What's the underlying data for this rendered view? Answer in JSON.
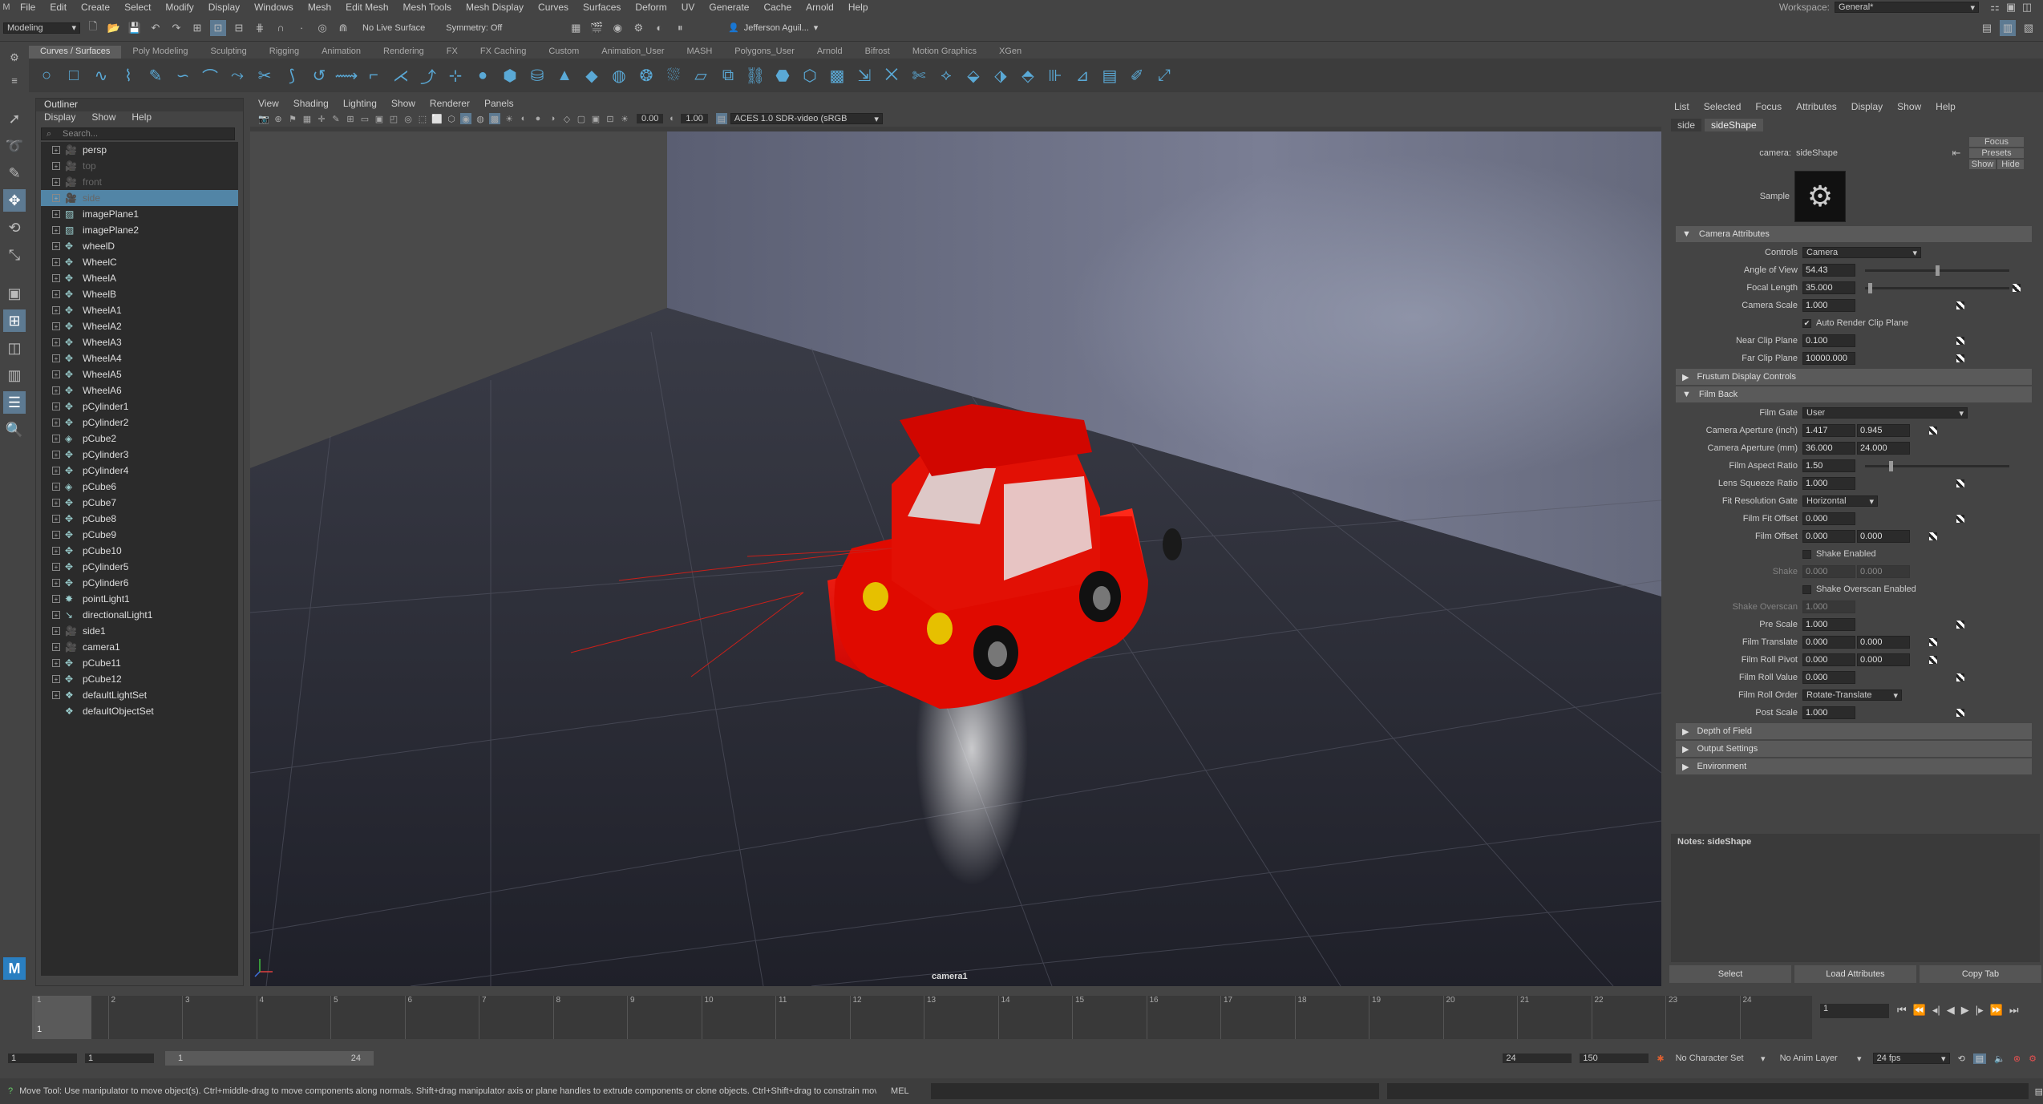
{
  "menubar": {
    "items": [
      "File",
      "Edit",
      "Create",
      "Select",
      "Modify",
      "Display",
      "Windows",
      "Mesh",
      "Edit Mesh",
      "Mesh Tools",
      "Mesh Display",
      "Curves",
      "Surfaces",
      "Deform",
      "UV",
      "Generate",
      "Cache",
      "Arnold",
      "Help"
    ],
    "workspace_label": "Workspace:",
    "workspace_value": "General*"
  },
  "statusline": {
    "mode": "Modeling",
    "live_surface": "No Live Surface",
    "symmetry": "Symmetry: Off",
    "user": "Jefferson Aguil..."
  },
  "shelf": {
    "tabs": [
      "Curves / Surfaces",
      "Poly Modeling",
      "Sculpting",
      "Rigging",
      "Animation",
      "Rendering",
      "FX",
      "FX Caching",
      "Custom",
      "Animation_User",
      "MASH",
      "Polygons_User",
      "Arnold",
      "Bifrost",
      "Motion Graphics",
      "XGen"
    ],
    "active_tab": "Curves / Surfaces"
  },
  "outliner": {
    "title": "Outliner",
    "menu": [
      "Display",
      "Show",
      "Help"
    ],
    "search_placeholder": "Search...",
    "items": [
      {
        "name": "persp",
        "icon": "camera-icon",
        "dim": false
      },
      {
        "name": "top",
        "icon": "camera-icon",
        "dim": true
      },
      {
        "name": "front",
        "icon": "camera-icon",
        "dim": true
      },
      {
        "name": "side",
        "icon": "camera-icon",
        "dim": true,
        "selected": true
      },
      {
        "name": "imagePlane1",
        "icon": "image-plane-icon"
      },
      {
        "name": "imagePlane2",
        "icon": "image-plane-icon"
      },
      {
        "name": "wheelD",
        "icon": "transform-icon"
      },
      {
        "name": "WheelC",
        "icon": "transform-icon"
      },
      {
        "name": "WheelA",
        "icon": "transform-icon"
      },
      {
        "name": "WheelB",
        "icon": "transform-icon"
      },
      {
        "name": "WheelA1",
        "icon": "transform-icon"
      },
      {
        "name": "WheelA2",
        "icon": "transform-icon"
      },
      {
        "name": "WheelA3",
        "icon": "transform-icon"
      },
      {
        "name": "WheelA4",
        "icon": "transform-icon"
      },
      {
        "name": "WheelA5",
        "icon": "transform-icon"
      },
      {
        "name": "WheelA6",
        "icon": "transform-icon"
      },
      {
        "name": "pCylinder1",
        "icon": "transform-icon"
      },
      {
        "name": "pCylinder2",
        "icon": "transform-icon"
      },
      {
        "name": "pCube2",
        "icon": "mesh-icon"
      },
      {
        "name": "pCylinder3",
        "icon": "transform-icon"
      },
      {
        "name": "pCylinder4",
        "icon": "transform-icon"
      },
      {
        "name": "pCube6",
        "icon": "mesh-icon"
      },
      {
        "name": "pCube7",
        "icon": "transform-icon"
      },
      {
        "name": "pCube8",
        "icon": "transform-icon"
      },
      {
        "name": "pCube9",
        "icon": "transform-icon"
      },
      {
        "name": "pCube10",
        "icon": "transform-icon"
      },
      {
        "name": "pCylinder5",
        "icon": "transform-icon"
      },
      {
        "name": "pCylinder6",
        "icon": "transform-icon"
      },
      {
        "name": "pointLight1",
        "icon": "point-light-icon"
      },
      {
        "name": "directionalLight1",
        "icon": "directional-light-icon"
      },
      {
        "name": "side1",
        "icon": "camera-icon"
      },
      {
        "name": "camera1",
        "icon": "camera-icon"
      },
      {
        "name": "pCube11",
        "icon": "transform-icon"
      },
      {
        "name": "pCube12",
        "icon": "transform-icon"
      },
      {
        "name": "defaultLightSet",
        "icon": "set-icon"
      },
      {
        "name": "defaultObjectSet",
        "icon": "set-icon"
      }
    ]
  },
  "viewport": {
    "menu": [
      "View",
      "Shading",
      "Lighting",
      "Show",
      "Renderer",
      "Panels"
    ],
    "exposure": "0.00",
    "gamma": "1.00",
    "colorspace": "ACES 1.0 SDR-video (sRGB",
    "camera_label": "camera1"
  },
  "attr": {
    "menu": [
      "List",
      "Selected",
      "Focus",
      "Attributes",
      "Display",
      "Show",
      "Help"
    ],
    "tabs": [
      "side",
      "sideShape"
    ],
    "active_tab": "sideShape",
    "camera_label": "camera:",
    "camera_value": "sideShape",
    "focus": "Focus",
    "presets": "Presets",
    "show": "Show",
    "hide": "Hide",
    "sample_label": "Sample",
    "section_camera": "Camera Attributes",
    "controls_label": "Controls",
    "controls_value": "Camera",
    "aov_label": "Angle of View",
    "aov_value": "54.43",
    "aov_fraction": 0.5,
    "focal_label": "Focal Length",
    "focal_value": "35.000",
    "focal_fraction": 0.02,
    "scale_label": "Camera Scale",
    "scale_value": "1.000",
    "auto_clip": "Auto Render Clip Plane",
    "near_label": "Near Clip Plane",
    "near_value": "0.100",
    "far_label": "Far Clip Plane",
    "far_value": "10000.000",
    "section_frustum": "Frustum Display Controls",
    "section_film": "Film Back",
    "gate_label": "Film Gate",
    "gate_value": "User",
    "ap_in_label": "Camera Aperture (inch)",
    "ap_in_x": "1.417",
    "ap_in_y": "0.945",
    "ap_mm_label": "Camera Aperture (mm)",
    "ap_mm_x": "36.000",
    "ap_mm_y": "24.000",
    "aspect_label": "Film Aspect Ratio",
    "aspect_value": "1.50",
    "aspect_fraction": 0.17,
    "squeeze_label": "Lens Squeeze Ratio",
    "squeeze_value": "1.000",
    "fitres_label": "Fit Resolution Gate",
    "fitres_value": "Horizontal",
    "fitoff_label": "Film Fit Offset",
    "fitoff_value": "0.000",
    "filmoff_label": "Film Offset",
    "filmoff_x": "0.000",
    "filmoff_y": "0.000",
    "shake_en": "Shake Enabled",
    "shake_label": "Shake",
    "shake_x": "0.000",
    "shake_y": "0.000",
    "shakeov_en": "Shake Overscan Enabled",
    "shakeov_label": "Shake Overscan",
    "shakeov_value": "1.000",
    "prescale_label": "Pre Scale",
    "prescale_value": "1.000",
    "trans_label": "Film Translate",
    "trans_x": "0.000",
    "trans_y": "0.000",
    "pivot_label": "Film Roll Pivot",
    "pivot_x": "0.000",
    "pivot_y": "0.000",
    "rollval_label": "Film Roll Value",
    "rollval_value": "0.000",
    "rollord_label": "Film Roll Order",
    "rollord_value": "Rotate-Translate",
    "post_label": "Post Scale",
    "post_value": "1.000",
    "section_dof": "Depth of Field",
    "section_output": "Output Settings",
    "section_env": "Environment",
    "notes": "Notes: sideShape",
    "btn_select": "Select",
    "btn_load": "Load Attributes",
    "btn_copy": "Copy Tab"
  },
  "timeline": {
    "ticks": [
      "1",
      "2",
      "3",
      "4",
      "5",
      "6",
      "7",
      "8",
      "9",
      "10",
      "11",
      "12",
      "13",
      "14",
      "15",
      "16",
      "17",
      "18",
      "19",
      "20",
      "21",
      "22",
      "23",
      "24"
    ],
    "current": "1",
    "current_frame_field": "1"
  },
  "range": {
    "start": "1",
    "start2": "1",
    "slider_start": "1",
    "slider_end": "24",
    "end": "24",
    "end2": "150",
    "char_set": "No Character Set",
    "anim_layer": "No Anim Layer",
    "fps": "24 fps"
  },
  "cmdline": {
    "help": "Move Tool: Use manipulator to move object(s). Ctrl+middle-drag to move components along normals. Shift+drag manipulator axis or plane handles to extrude components or clone objects. Ctrl+Shift+drag to constrain movement to a cor",
    "lang": "MEL"
  }
}
